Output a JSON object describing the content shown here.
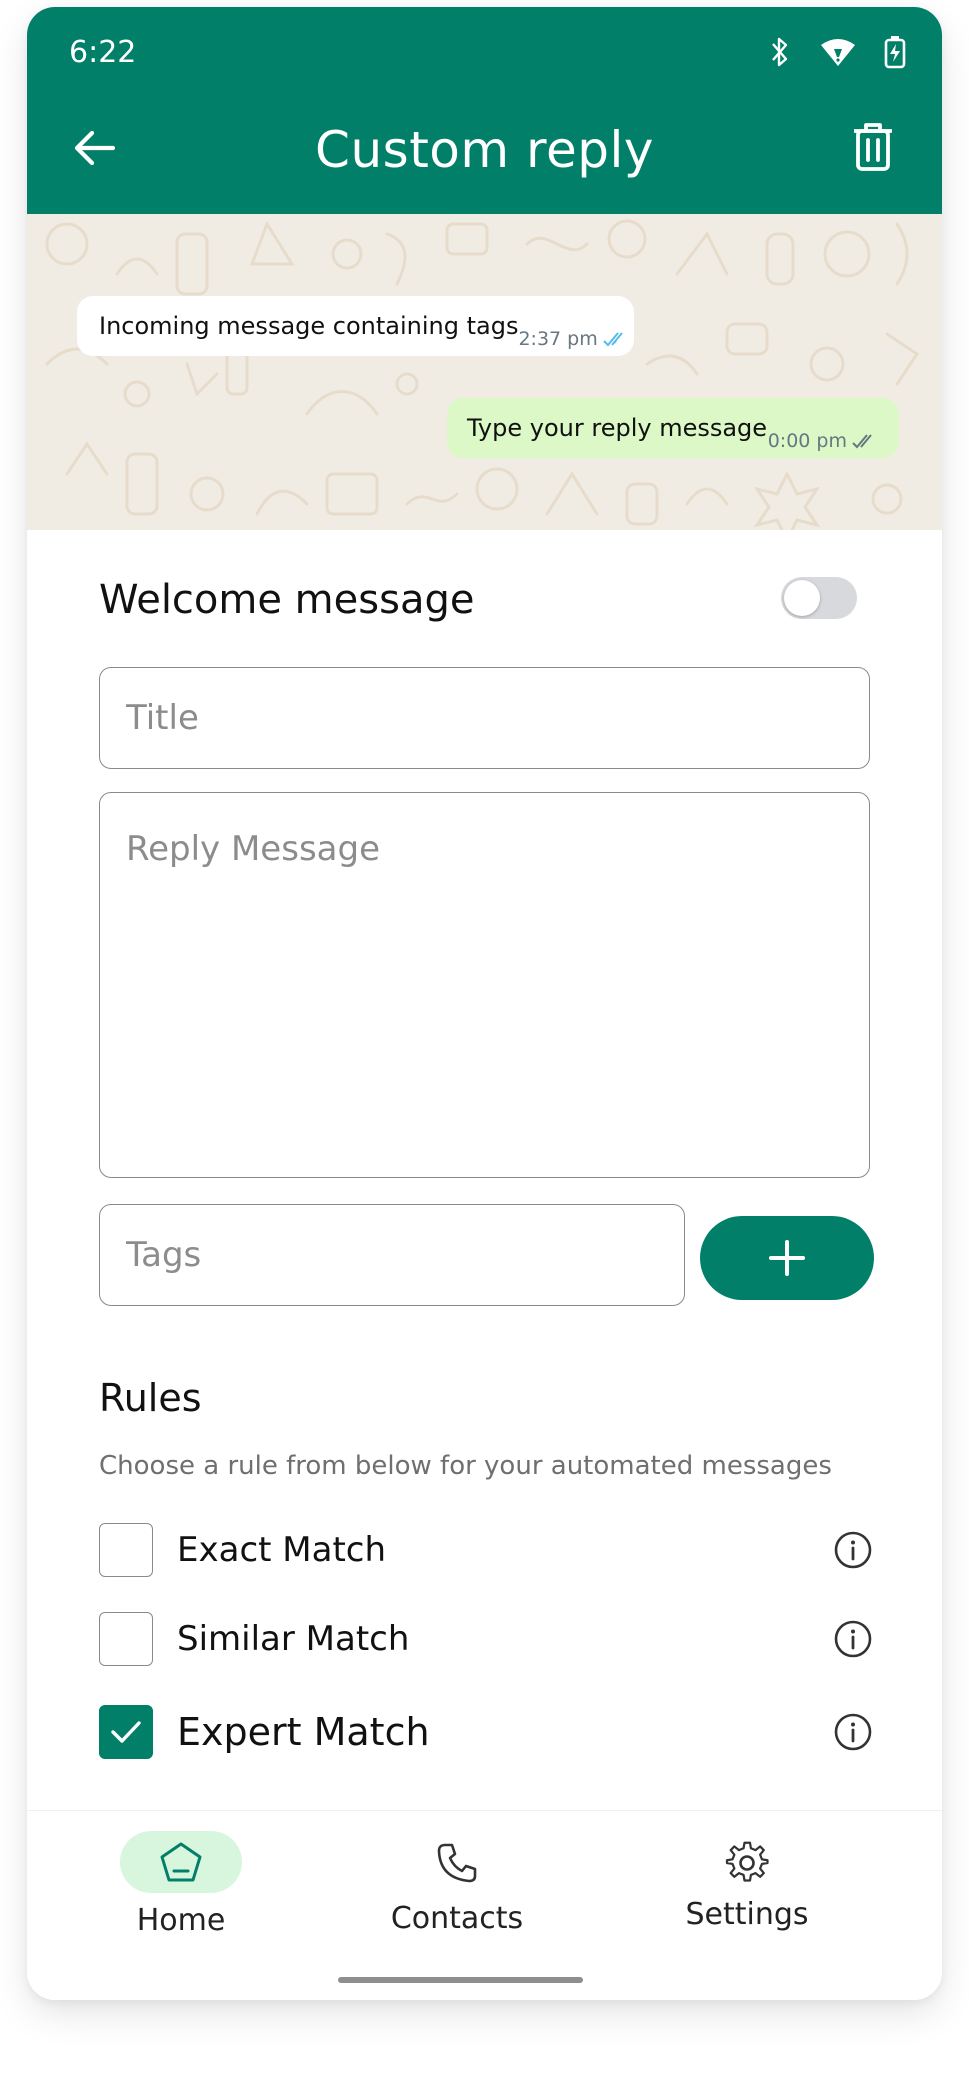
{
  "status_bar": {
    "time": "6:22",
    "icons": [
      "bluetooth-icon",
      "wifi-icon",
      "battery-charging-icon"
    ]
  },
  "app_bar": {
    "title": "Custom reply",
    "back_icon": "arrow-left-icon",
    "delete_icon": "trash-icon"
  },
  "preview": {
    "incoming": {
      "text": "Incoming message containing tags",
      "time": "2:37 pm",
      "ticks": "double-check-blue"
    },
    "outgoing": {
      "text": "Type your reply message",
      "time": "0:00 pm",
      "ticks": "double-check-gray"
    }
  },
  "welcome": {
    "label": "Welcome message",
    "enabled": false
  },
  "form": {
    "title_placeholder": "Title",
    "reply_placeholder": "Reply Message",
    "tags_placeholder": "Tags",
    "add_icon": "plus-icon"
  },
  "rules": {
    "title": "Rules",
    "subtitle": "Choose a rule from below for your automated messages",
    "items": [
      {
        "label": "Exact Match",
        "checked": false
      },
      {
        "label": "Similar Match",
        "checked": false
      },
      {
        "label": "Expert Match",
        "checked": true
      }
    ]
  },
  "nav": {
    "items": [
      {
        "label": "Home",
        "icon": "home-icon",
        "active": true
      },
      {
        "label": "Contacts",
        "icon": "phone-icon",
        "active": false
      },
      {
        "label": "Settings",
        "icon": "gear-icon",
        "active": false
      }
    ]
  },
  "colors": {
    "primary": "#017f68",
    "chat_bg": "#f1ece3",
    "outgoing_bubble": "#dcf8c6",
    "active_nav_pill": "#d8f5dd"
  }
}
